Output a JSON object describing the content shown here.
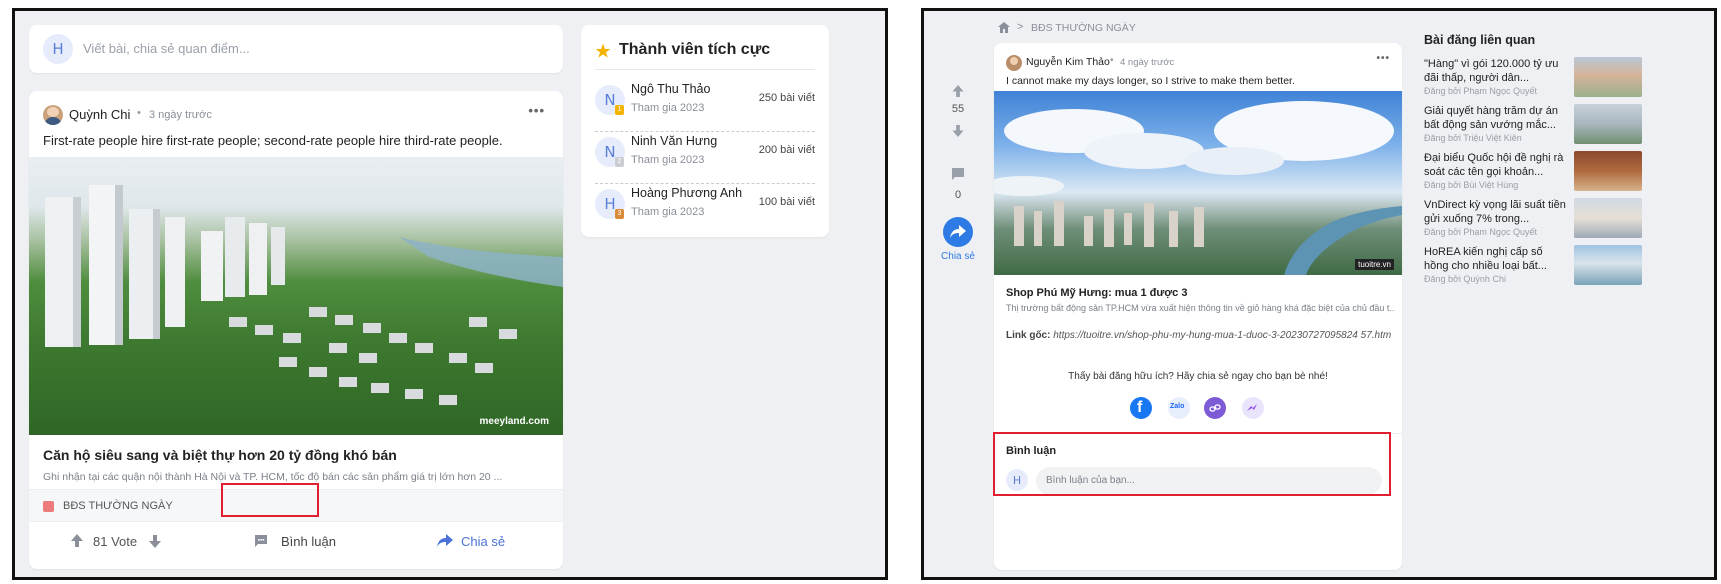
{
  "feed": {
    "composer": {
      "avatar": "H",
      "placeholder": "Viết bài, chia sẻ quan điểm..."
    },
    "post": {
      "author": "Quỳnh Chi",
      "time": "3 ngày trước",
      "text": "First-rate people hire first-rate people; second-rate people hire third-rate people.",
      "image_watermark": "meeyland.com",
      "link_title": "Căn hộ siêu sang và biệt thự hơn 20 tỷ đồng khó bán",
      "link_desc": "Ghi nhận tại các quận nội thành Hà Nội và TP. HCM, tốc độ bán các sản phẩm giá trị lớn hơn 20 ...",
      "category": "BĐS THƯỜNG NGÀY",
      "votes": "81 Vote",
      "comment_label": "Bình luận",
      "share_label": "Chia sẻ"
    },
    "members": {
      "title": "Thành viên tích cực",
      "items": [
        {
          "avatar": "N",
          "name": "Ngô Thu Thảo",
          "joined": "Tham gia 2023",
          "posts": "250 bài viết",
          "rank": "1",
          "rank_color": "#f5b301"
        },
        {
          "avatar": "N",
          "name": "Ninh Văn Hưng",
          "joined": "Tham gia 2023",
          "posts": "200 bài viết",
          "rank": "2",
          "rank_color": "#c9ccd2"
        },
        {
          "avatar": "H",
          "name": "Hoàng Phương Anh",
          "joined": "Tham gia 2023",
          "posts": "100 bài viết",
          "rank": "3",
          "rank_color": "#d98b3a"
        }
      ]
    }
  },
  "detail": {
    "breadcrumb": "BĐS THƯỜNG NGÀY",
    "vote_count": "55",
    "comment_count": "0",
    "share_label": "Chia sẻ",
    "post": {
      "author": "Nguyễn Kim Thảo",
      "time": "4 ngày trước",
      "text": "I cannot make my days longer, so I strive to make them better.",
      "image_watermark": "tuoitre.vn",
      "link_title": "Shop Phú Mỹ Hưng: mua 1 được 3",
      "link_desc": "Thị trường bất động sản TP.HCM vừa xuất hiện thông tin về giỏ hàng khá đặc biệt của chủ đầu t...",
      "source_label": "Link gốc:",
      "source_url": "https://tuoitre.vn/shop-phu-my-hung-mua-1-duoc-3-20230727095824 57.htm",
      "share_prompt": "Thấy bài đăng hữu ích? Hãy chia sẻ ngay cho bạn bè nhé!",
      "share_icons": [
        "facebook-icon",
        "zalo-icon",
        "link-icon",
        "messenger-icon"
      ],
      "comments_title": "Bình luận",
      "comment_avatar": "H",
      "comment_placeholder": "Bình luận của bạn..."
    },
    "related": {
      "title": "Bài đăng liên quan",
      "items": [
        {
          "title": "\"Hàng\" vì gói 120.000 tỷ ưu đãi thấp, người dân...",
          "by": "Đăng bởi Phạm Ngọc Quyết"
        },
        {
          "title": "Giải quyết hàng trăm dự án bất động sản vướng mắc...",
          "by": "Đăng bởi Triệu Việt Kiên"
        },
        {
          "title": "Đại biểu Quốc hội đề nghị rà soát các tên gọi khoản...",
          "by": "Đăng bởi Bùi Việt Hùng"
        },
        {
          "title": "VnDirect kỳ vọng lãi suất tiền gửi xuống 7% trong...",
          "by": "Đăng bởi Phạm Ngọc Quyết"
        },
        {
          "title": "HoREA kiến nghị cấp số hồng cho nhiều loại bất...",
          "by": "Đăng bởi Quỳnh Chi"
        }
      ]
    }
  }
}
